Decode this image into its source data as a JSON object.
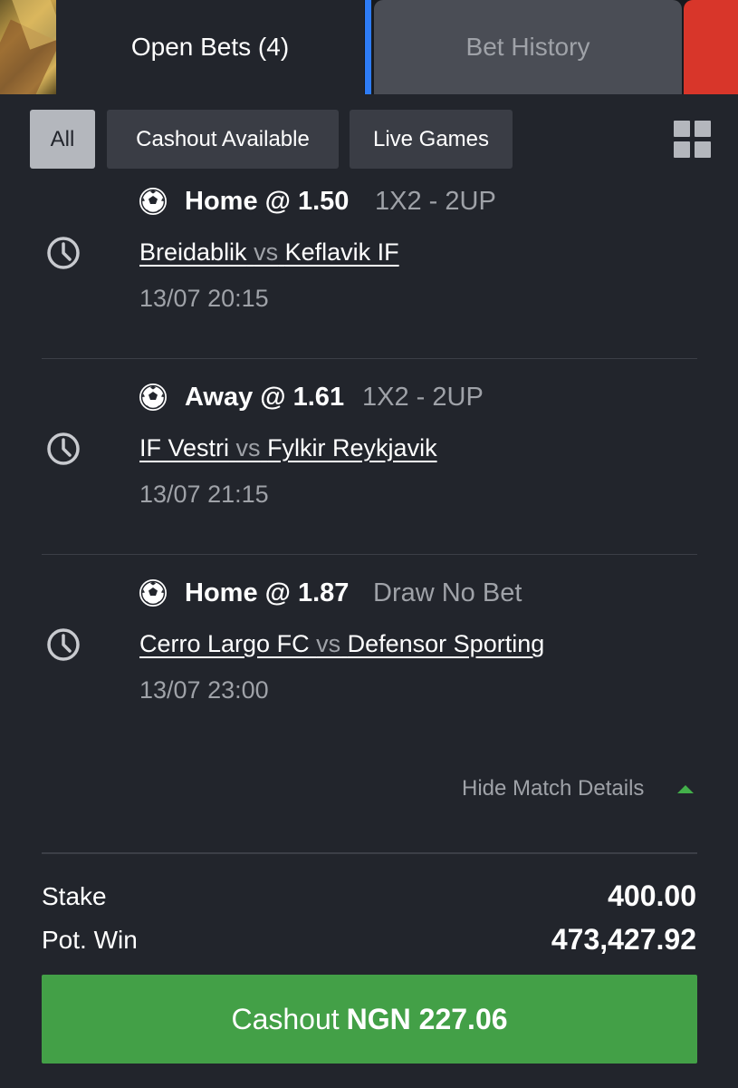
{
  "tabs": {
    "open_bets": "Open Bets (4)",
    "bet_history": "Bet History"
  },
  "filters": {
    "all": "All",
    "cashout_available": "Cashout Available",
    "live_games": "Live Games"
  },
  "bets": [
    {
      "selection": "Home @ 1.50",
      "market": "1X2  -  2UP",
      "home_team": "Breidablik",
      "vs": "vs",
      "away_team": "Keflavik IF",
      "datetime": "13/07 20:15"
    },
    {
      "selection": "Away @ 1.61",
      "market": "1X2  -  2UP",
      "home_team": "IF Vestri",
      "vs": "vs",
      "away_team": "Fylkir Reykjavik",
      "datetime": "13/07 21:15"
    },
    {
      "selection": "Home @ 1.87",
      "market": "Draw No Bet",
      "home_team": "Cerro Largo FC",
      "vs": "vs",
      "away_team": "Defensor Sporting",
      "datetime": "13/07 23:00"
    }
  ],
  "details_toggle": "Hide Match Details",
  "summary": {
    "stake_label": "Stake",
    "stake_value": "400.00",
    "pot_win_label": "Pot. Win",
    "pot_win_value": "473,427.92"
  },
  "cashout": {
    "label": "Cashout",
    "amount": "NGN 227.06"
  },
  "colors": {
    "accent_green": "#43a047",
    "tab_blue": "#2e7cf6",
    "tab_red": "#d8362a"
  }
}
